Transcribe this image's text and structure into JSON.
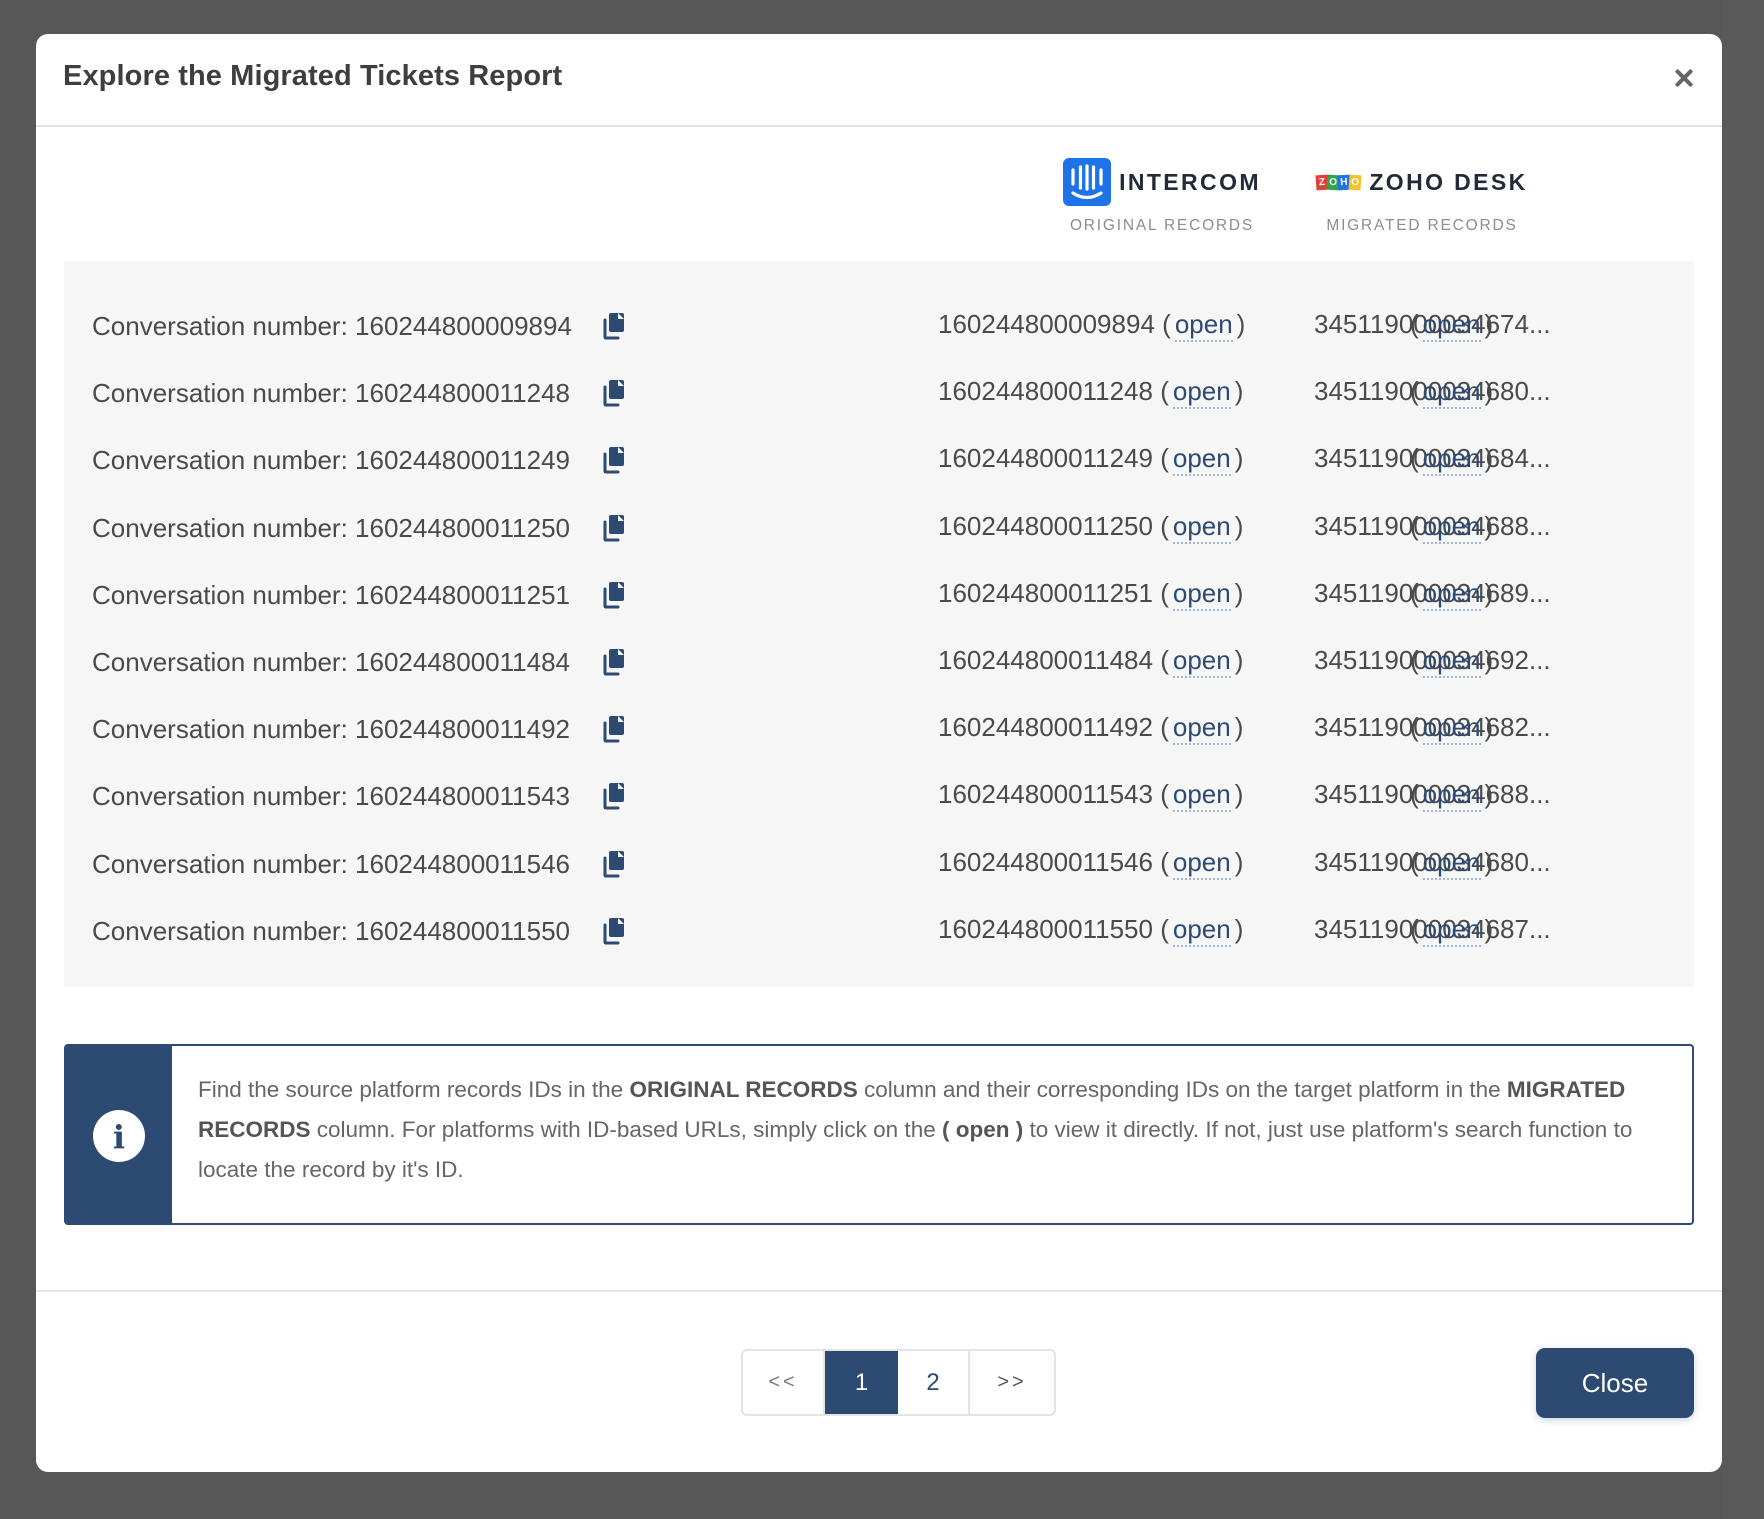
{
  "modal": {
    "title": "Explore the Migrated Tickets Report"
  },
  "platforms": {
    "source": {
      "name": "INTERCOM",
      "subtitle": "ORIGINAL RECORDS",
      "logo": "intercom-logo",
      "brand_color": "#1f73e8"
    },
    "target": {
      "name": "ZOHO DESK",
      "subtitle": "MIGRATED RECORDS",
      "logo": "zoho-logo",
      "logo_letters": [
        "Z",
        "O",
        "H",
        "O"
      ],
      "logo_colors": [
        "#e0403a",
        "#2ea44f",
        "#1f73e8",
        "#f5c229"
      ]
    }
  },
  "records": [
    {
      "label": "Conversation number: 160244800009894",
      "original_id": "160244800009894",
      "migrated_id": "345119000034674...",
      "open_label": "open"
    },
    {
      "label": "Conversation number: 160244800011248",
      "original_id": "160244800011248",
      "migrated_id": "345119000034680...",
      "open_label": "open"
    },
    {
      "label": "Conversation number: 160244800011249",
      "original_id": "160244800011249",
      "migrated_id": "345119000034684...",
      "open_label": "open"
    },
    {
      "label": "Conversation number: 160244800011250",
      "original_id": "160244800011250",
      "migrated_id": "345119000034688...",
      "open_label": "open"
    },
    {
      "label": "Conversation number: 160244800011251",
      "original_id": "160244800011251",
      "migrated_id": "345119000034689...",
      "open_label": "open"
    },
    {
      "label": "Conversation number: 160244800011484",
      "original_id": "160244800011484",
      "migrated_id": "345119000034692...",
      "open_label": "open"
    },
    {
      "label": "Conversation number: 160244800011492",
      "original_id": "160244800011492",
      "migrated_id": "345119000034682...",
      "open_label": "open"
    },
    {
      "label": "Conversation number: 160244800011543",
      "original_id": "160244800011543",
      "migrated_id": "345119000034688...",
      "open_label": "open"
    },
    {
      "label": "Conversation number: 160244800011546",
      "original_id": "160244800011546",
      "migrated_id": "345119000034680...",
      "open_label": "open"
    },
    {
      "label": "Conversation number: 160244800011550",
      "original_id": "160244800011550",
      "migrated_id": "345119000034687...",
      "open_label": "open"
    }
  ],
  "info": {
    "icon": "info-icon",
    "segments": [
      {
        "text": "Find the source platform records IDs in the ",
        "bold": false
      },
      {
        "text": "ORIGINAL RECORDS",
        "bold": true
      },
      {
        "text": " column and their corresponding IDs on the target platform in the ",
        "bold": false
      },
      {
        "text": "MIGRATED RECORDS",
        "bold": true
      },
      {
        "text": " column. For platforms with ID-based URLs, simply click on the ",
        "bold": false
      },
      {
        "text": "( open )",
        "bold": true
      },
      {
        "text": " to view it directly. If not, just use platform's search function to locate the record by it's ID.",
        "bold": false
      }
    ]
  },
  "pagination": {
    "prev_label": "<<",
    "pages": [
      "1",
      "2"
    ],
    "current_page": "1",
    "next_label": ">>"
  },
  "footer": {
    "close_label": "Close"
  },
  "colors": {
    "accent": "#2d4a72",
    "backdrop": "#575757",
    "panel": "#f6f6f6"
  }
}
